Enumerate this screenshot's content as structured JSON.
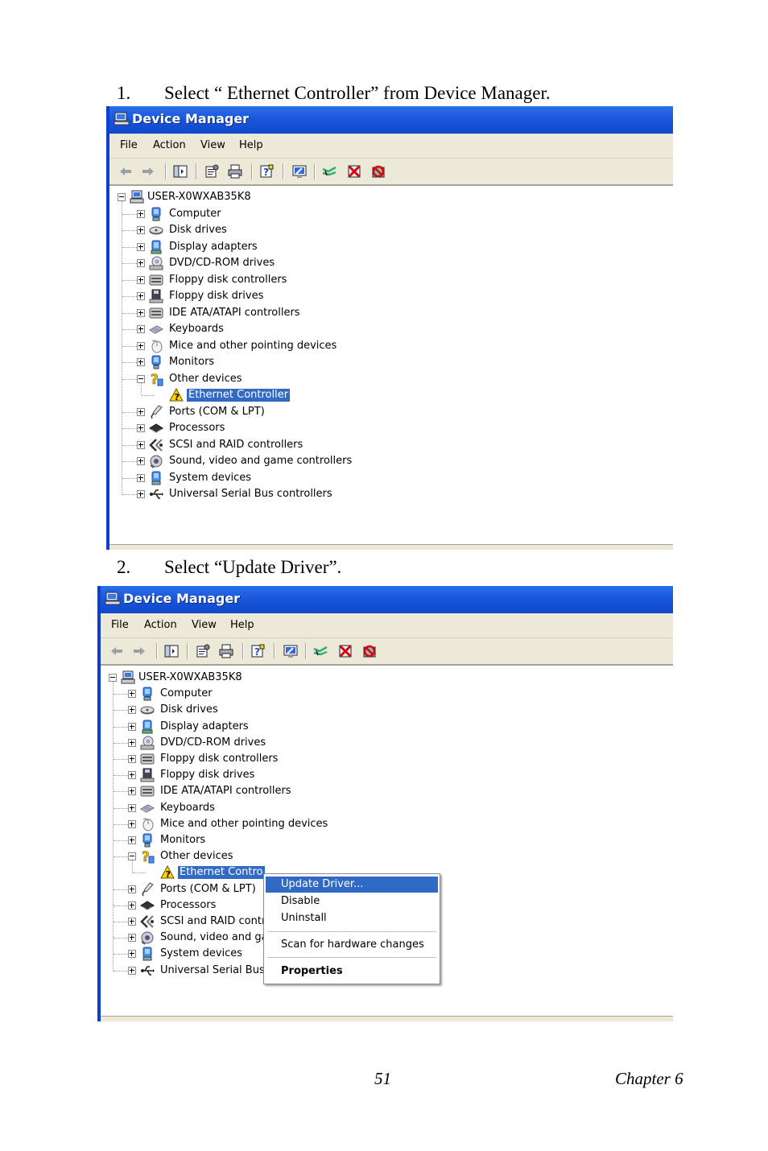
{
  "steps": [
    {
      "number": "1.",
      "text": "Select “ Ethernet Controller” from Device Manager."
    },
    {
      "number": "2.",
      "text": "Select “Update Driver”."
    }
  ],
  "window": {
    "title": "Device Manager",
    "menu": [
      "File",
      "Action",
      "View",
      "Help"
    ],
    "toolbar_icons": [
      "back-arrow-icon",
      "forward-arrow-icon",
      "show-hide-console-tree-icon",
      "properties-icon",
      "print-icon",
      "help-icon",
      "scan-hardware-icon",
      "update-driver-icon",
      "uninstall-icon",
      "disable-icon"
    ],
    "root": "USER-X0WXAB35K8",
    "categories": [
      {
        "label": "Computer",
        "icon": "computer-icon"
      },
      {
        "label": "Disk drives",
        "icon": "disk-drive-icon"
      },
      {
        "label": "Display adapters",
        "icon": "display-adapter-icon"
      },
      {
        "label": "DVD/CD-ROM drives",
        "icon": "dvd-drive-icon"
      },
      {
        "label": "Floppy disk controllers",
        "icon": "floppy-controller-icon"
      },
      {
        "label": "Floppy disk drives",
        "icon": "floppy-drive-icon"
      },
      {
        "label": "IDE ATA/ATAPI controllers",
        "icon": "ide-controller-icon"
      },
      {
        "label": "Keyboards",
        "icon": "keyboard-icon"
      },
      {
        "label": "Mice and other pointing devices",
        "icon": "mouse-icon"
      },
      {
        "label": "Monitors",
        "icon": "monitor-icon"
      },
      {
        "label": "Other devices",
        "icon": "unknown-device-icon"
      },
      {
        "label": "Ports (COM & LPT)",
        "icon": "port-icon"
      },
      {
        "label": "Processors",
        "icon": "processor-icon"
      },
      {
        "label": "SCSI and RAID controllers",
        "icon": "scsi-controller-icon"
      },
      {
        "label": "Sound, video and game controllers",
        "icon": "sound-icon"
      },
      {
        "label": "System devices",
        "icon": "system-device-icon"
      },
      {
        "label": "Universal Serial Bus controllers",
        "icon": "usb-icon"
      }
    ],
    "selected_device": {
      "label": "Ethernet Controller",
      "icon": "warning-device-icon"
    }
  },
  "window2_truncated": {
    "ethernet": "Ethernet Contro",
    "scsi": "SCSI and RAID contr",
    "sound": "Sound, video and ga",
    "usb": "Universal Serial Bus"
  },
  "context_menu": {
    "items": [
      "Update Driver...",
      "Disable",
      "Uninstall",
      "Scan for hardware changes",
      "Properties"
    ],
    "highlighted": "Update Driver..."
  },
  "footer": {
    "page": "51",
    "chapter": "Chapter 6"
  },
  "colors": {
    "titlebar": "#1855dc",
    "selection": "#316ac5",
    "menubar": "#ece9d8"
  }
}
